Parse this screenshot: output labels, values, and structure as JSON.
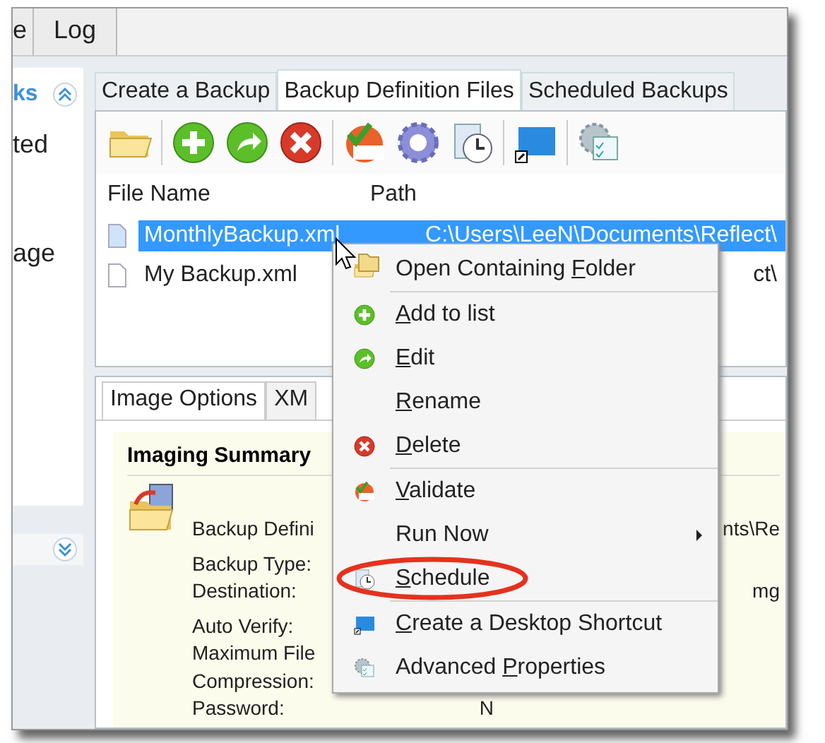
{
  "top_tabs": [
    {
      "label": "e",
      "selected": false
    },
    {
      "label": "Log",
      "selected": false
    }
  ],
  "sidebar": {
    "header": "ks",
    "items": [
      "ted",
      "age"
    ]
  },
  "tabs": [
    {
      "label": "Create a Backup",
      "selected": false
    },
    {
      "label": "Backup Definition Files",
      "selected": true
    },
    {
      "label": "Scheduled Backups",
      "selected": false
    }
  ],
  "file_list": {
    "columns": [
      "File Name",
      "Path"
    ],
    "rows": [
      {
        "name": "MonthlyBackup.xml",
        "path": "C:\\Users\\LeeN\\Documents\\Reflect\\",
        "selected": true
      },
      {
        "name": "My Backup.xml",
        "path": "ct\\",
        "selected": false
      }
    ]
  },
  "lower_tabs": [
    {
      "label": "Image Options",
      "selected": true
    },
    {
      "label": "XM",
      "selected": false
    }
  ],
  "summary": {
    "title": "Imaging Summary",
    "fields": [
      {
        "label": "Backup Defini",
        "value": "nts\\Re"
      },
      {
        "label": "Backup Type:"
      },
      {
        "label": "Destination:",
        "value": "mg"
      },
      {
        "label": "Auto Verify:"
      },
      {
        "label": "Maximum File"
      },
      {
        "label": "Compression:"
      },
      {
        "label": "Password:",
        "value": "N",
        "near": true
      }
    ]
  },
  "context_menu": [
    {
      "before": "Open Containing ",
      "key": "F",
      "after": "older",
      "separator_after": true
    },
    {
      "key": "A",
      "after": "dd to list"
    },
    {
      "key": "E",
      "after": "dit"
    },
    {
      "key": "R",
      "after": "ename"
    },
    {
      "key": "D",
      "after": "elete",
      "separator_after": true
    },
    {
      "key": "V",
      "after": "alidate"
    },
    {
      "before": "Run Now",
      "submenu": true
    },
    {
      "key": "S",
      "after": "chedule",
      "separator_after": true,
      "circled": true
    },
    {
      "key": "C",
      "after": "reate a Desktop Shortcut"
    },
    {
      "before": "Advanced ",
      "key": "P",
      "after": "roperties"
    }
  ]
}
